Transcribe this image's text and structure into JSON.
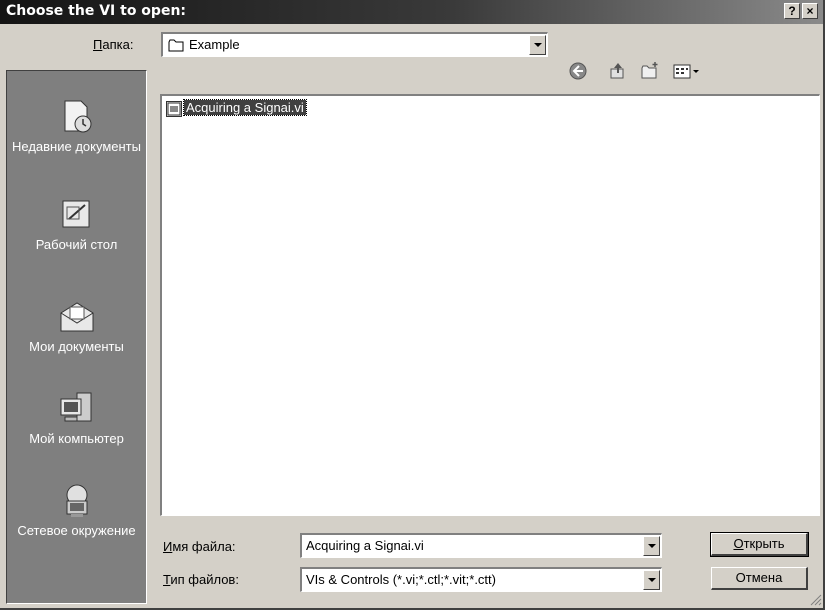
{
  "window": {
    "title": "Choose the VI to open:",
    "help_btn": "?",
    "close_btn": "×"
  },
  "lookin": {
    "label_first": "П",
    "label_rest": "апка:",
    "value": "Example"
  },
  "toolbar": {
    "icons": [
      "back-icon",
      "up-folder-icon",
      "new-folder-icon",
      "view-menu-icon"
    ]
  },
  "places": {
    "recent": "Недавние документы",
    "desktop": "Рабочий стол",
    "mydocs": "Мои документы",
    "mycomputer": "Мой компьютер",
    "network": "Сетевое окружение"
  },
  "files": [
    {
      "name": "Acquiring a Signai.vi",
      "selected": true
    }
  ],
  "filename": {
    "label_first": "И",
    "label_rest": "мя файла:",
    "value": "Acquiring a Signai.vi"
  },
  "filetype": {
    "label_first": "Т",
    "label_rest": "ип файлов:",
    "value": "VIs & Controls (*.vi;*.ctl;*.vit;*.ctt)"
  },
  "buttons": {
    "open_first": "О",
    "open_rest": "ткрыть",
    "cancel": "Отмена"
  }
}
